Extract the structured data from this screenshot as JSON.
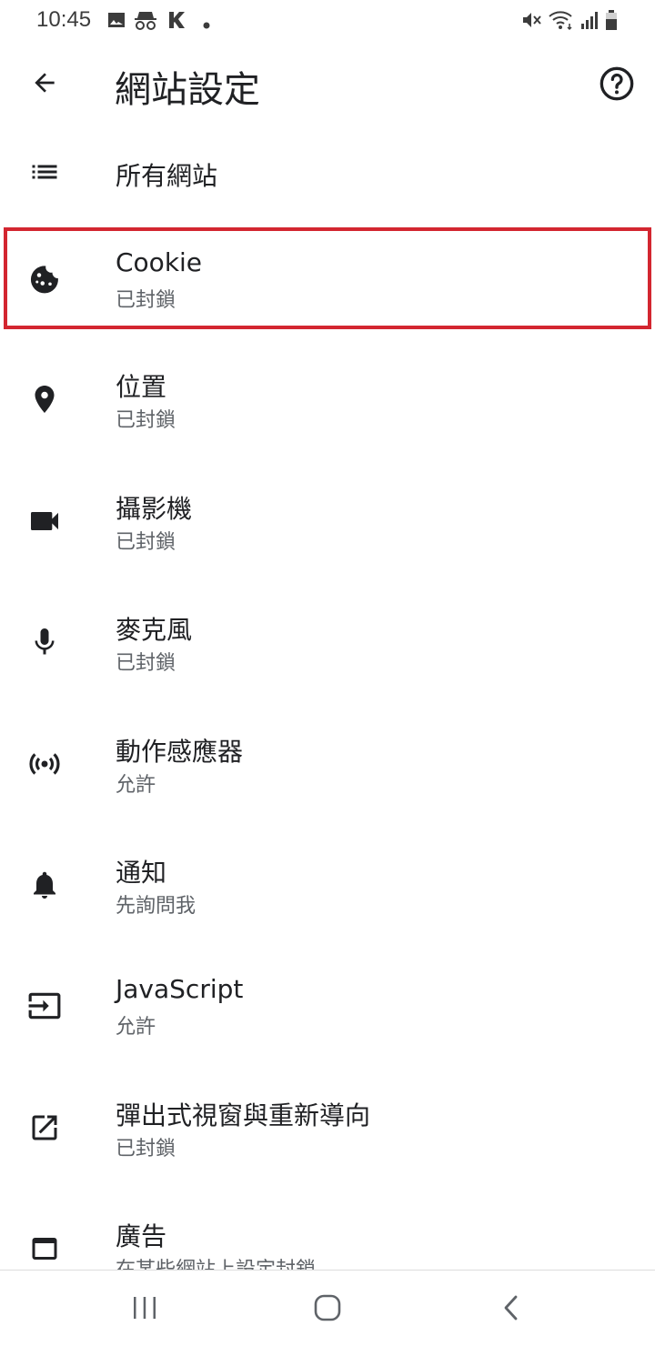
{
  "status_bar": {
    "time": "10:45",
    "left_icons": [
      "image-icon",
      "incognito-icon",
      "k-app-icon",
      "dot-icon"
    ],
    "right_icons": [
      "mute-icon",
      "wifi-icon",
      "signal-icon",
      "battery-icon"
    ]
  },
  "app_bar": {
    "title": "網站設定",
    "back_icon": "arrow-back-icon",
    "help_icon": "help-icon"
  },
  "items": [
    {
      "title": "所有網站",
      "subtitle": "",
      "icon": "list-icon"
    },
    {
      "title": "Cookie",
      "subtitle": "已封鎖",
      "icon": "cookie-icon",
      "highlighted": true
    },
    {
      "title": "位置",
      "subtitle": "已封鎖",
      "icon": "location-icon"
    },
    {
      "title": "攝影機",
      "subtitle": "已封鎖",
      "icon": "camera-icon"
    },
    {
      "title": "麥克風",
      "subtitle": "已封鎖",
      "icon": "microphone-icon"
    },
    {
      "title": "動作感應器",
      "subtitle": "允許",
      "icon": "sensors-icon"
    },
    {
      "title": "通知",
      "subtitle": "先詢問我",
      "icon": "bell-icon"
    },
    {
      "title": "JavaScript",
      "subtitle": "允許",
      "icon": "javascript-icon"
    },
    {
      "title": "彈出式視窗與重新導向",
      "subtitle": "已封鎖",
      "icon": "popup-icon"
    },
    {
      "title": "廣告",
      "subtitle": "在某些網站上設定封鎖",
      "icon": "ads-icon"
    }
  ],
  "colors": {
    "highlight": "#d32630",
    "title_text": "#202124",
    "subtitle_text": "#5f6368",
    "icon": "#202124"
  },
  "nav_bar": {
    "buttons": [
      "recent-apps-icon",
      "home-icon",
      "back-nav-icon"
    ]
  }
}
